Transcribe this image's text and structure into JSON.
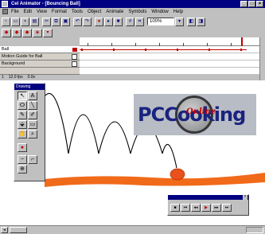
{
  "window": {
    "title": "Cel Animator - [Bouncing Ball]",
    "controls": [
      "_",
      "□",
      "×"
    ]
  },
  "menu": {
    "items": [
      "File",
      "Edit",
      "View",
      "Format",
      "Tools",
      "Object",
      "Animate",
      "Symbols",
      "Window",
      "Help"
    ]
  },
  "toolbar": {
    "zoom_value": "100%"
  },
  "timeline": {
    "layers": [
      {
        "name": "Ball"
      },
      {
        "name": "Motion Guide for Ball"
      },
      {
        "name": "Background"
      }
    ],
    "status_frame": "1",
    "status_fps": "12.0 fps",
    "status_time": "0.0s"
  },
  "toolbox": {
    "title": "Drawing"
  },
  "logo": {
    "brand_text": "PCCooking",
    "script_text": "Online"
  },
  "colors": {
    "title_bar": "#000080",
    "ball": "#e8501c",
    "ground": "#f06a1a",
    "keyframe": "#c00000"
  }
}
